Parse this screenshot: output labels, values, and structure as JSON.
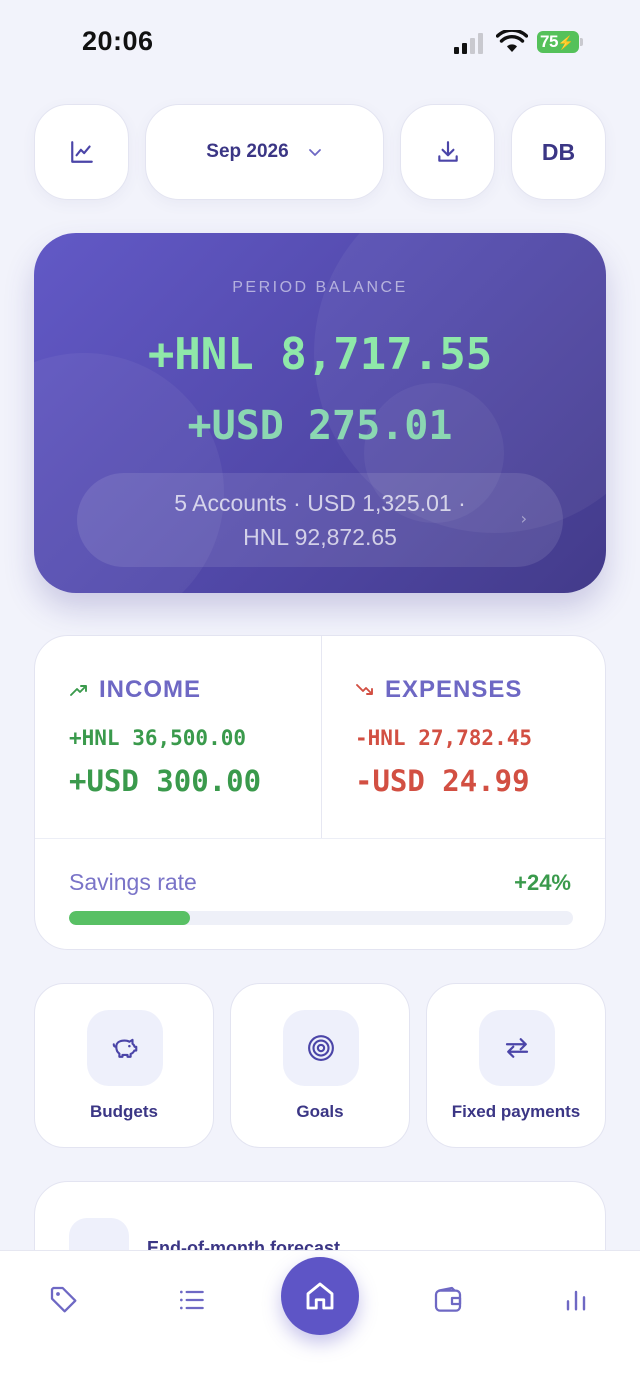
{
  "status_bar": {
    "time": "20:06",
    "battery": "75"
  },
  "header": {
    "month": "Sep 2026",
    "avatar_initials": "DB"
  },
  "balance": {
    "label": "PERIOD BALANCE",
    "primary": "+HNL 8,717.55",
    "secondary": "+USD 275.01",
    "accounts_line1": "5 Accounts · USD 1,325.01 ·",
    "accounts_line2": "HNL 92,872.65"
  },
  "summary": {
    "income": {
      "label": "INCOME",
      "hnl": "+HNL 36,500.00",
      "usd": "+USD 300.00"
    },
    "expenses": {
      "label": "EXPENSES",
      "hnl": "-HNL 27,782.45",
      "usd": "-USD 24.99"
    },
    "savings_label": "Savings rate",
    "savings_value": "+24%",
    "savings_fraction": 0.24
  },
  "quick_actions": [
    {
      "label": "Budgets",
      "icon": "piggy-bank-icon"
    },
    {
      "label": "Goals",
      "icon": "target-icon"
    },
    {
      "label": "Fixed payments",
      "icon": "repeat-icon"
    }
  ],
  "forecast": {
    "title": "End-of-month forecast"
  },
  "nav": [
    "tag-icon",
    "list-icon",
    "home-icon",
    "wallet-icon",
    "bar-chart-icon"
  ],
  "colors": {
    "accent": "#5e55c6",
    "income": "#3a9a4c",
    "expense": "#d24f42",
    "balance_text": "#8fe8a9"
  }
}
